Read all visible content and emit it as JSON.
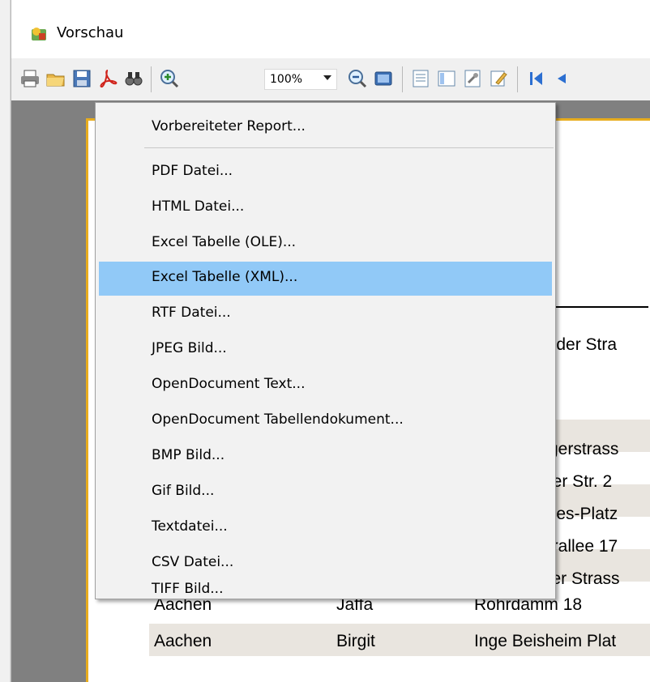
{
  "window": {
    "title": "Vorschau"
  },
  "toolbar": {
    "zoom_value": "100%",
    "buttons": [
      "print-icon",
      "open-icon",
      "save-icon",
      "pdf-icon",
      "find-icon",
      "zoom-in-icon",
      "zoom-out-icon",
      "page-width-icon",
      "outline-icon",
      "thumbnails-icon",
      "page-settings-icon",
      "edit-icon",
      "first-page-icon"
    ]
  },
  "menu": {
    "items": [
      "Vorbereiteter Report...",
      "PDF Datei...",
      "HTML Datei...",
      "Excel Tabelle (OLE)...",
      "Excel Tabelle (XML)...",
      "RTF Datei...",
      "JPEG Bild...",
      "OpenDocument Text...",
      "OpenDocument Tabellendokument...",
      "BMP Bild...",
      "Gif Bild...",
      "Textdatei...",
      "CSV Datei...",
      "TIFF Bild..."
    ],
    "highlighted": "Excel Tabelle (XML)..."
  },
  "report": {
    "fragments": [
      "alder Stra",
      "rgerstrass",
      "ner Str. 2",
      "eles-Platz",
      "erallee 17",
      "zer Strass"
    ],
    "row_jaffa": {
      "city": "Aachen",
      "name": "Jaffa",
      "street": "Rohrdamm 18"
    },
    "row_birgit": {
      "city": "Aachen",
      "name": "Birgit",
      "street": "Inge Beisheim Plat"
    }
  },
  "colors": {
    "menu_highlight": "#91c9f7",
    "page_border": "#e8ad1e",
    "row_stripe": "#e9e5df"
  }
}
